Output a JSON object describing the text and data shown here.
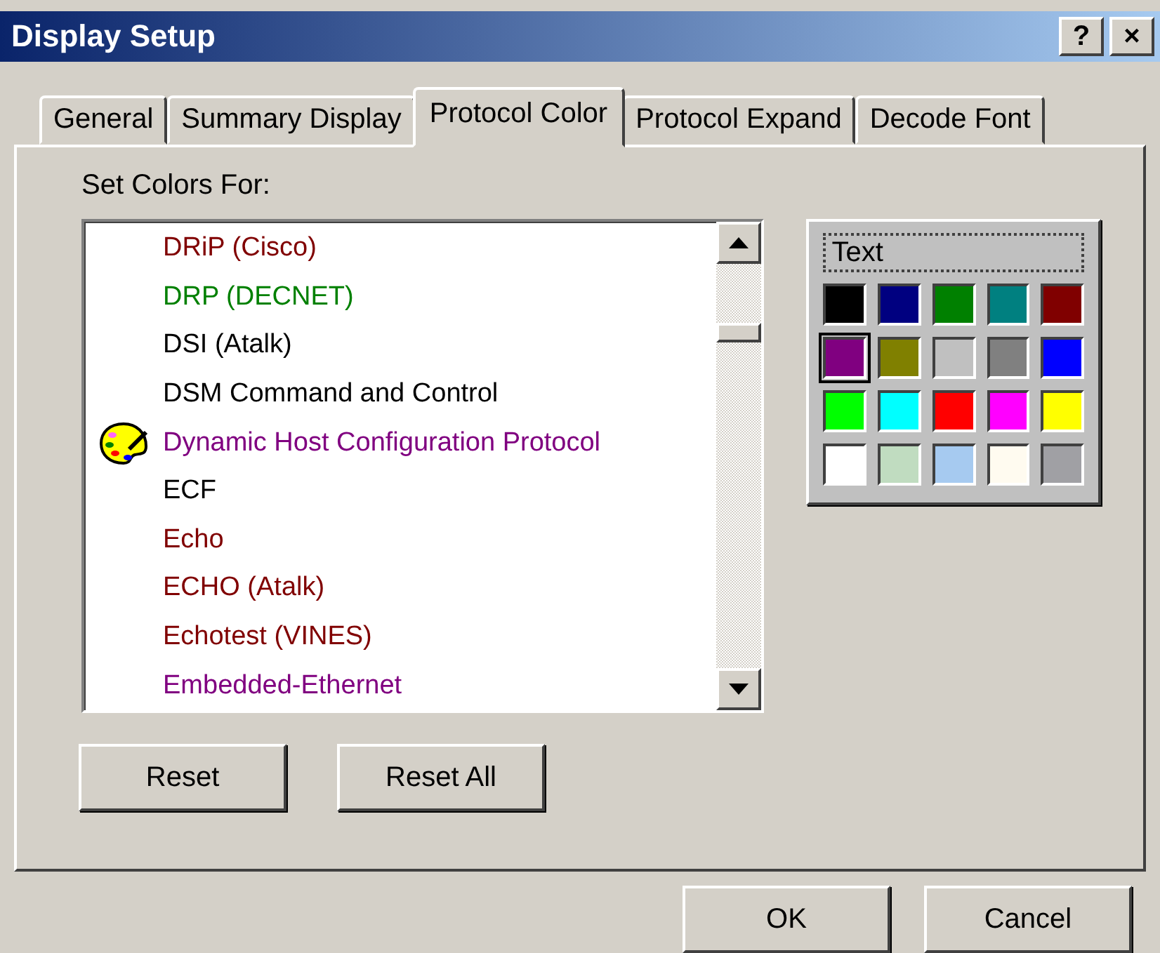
{
  "window": {
    "title": "Display Setup",
    "title_buttons": [
      "?",
      "×"
    ]
  },
  "tabs": [
    {
      "label": "General",
      "selected": false
    },
    {
      "label": "Summary Display",
      "selected": false
    },
    {
      "label": "Protocol Color",
      "selected": true
    },
    {
      "label": "Protocol Expand",
      "selected": false
    },
    {
      "label": "Decode Font",
      "selected": false
    }
  ],
  "list_label": {
    "text": "Set Colors For:"
  },
  "protocols": [
    {
      "name": "DRiP (Cisco)",
      "color": "#800000",
      "selected": false
    },
    {
      "name": "DRP (DECNET)",
      "color": "#008000",
      "selected": false
    },
    {
      "name": "DSI (Atalk)",
      "color": "#000000",
      "selected": false
    },
    {
      "name": "DSM Command and Control",
      "color": "#000000",
      "selected": false
    },
    {
      "name": "Dynamic Host Configuration Protocol",
      "color": "#800080",
      "selected": true
    },
    {
      "name": "ECF",
      "color": "#000000",
      "selected": false
    },
    {
      "name": "Echo",
      "color": "#800000",
      "selected": false
    },
    {
      "name": "ECHO (Atalk)",
      "color": "#800000",
      "selected": false
    },
    {
      "name": "Echotest (VINES)",
      "color": "#800000",
      "selected": false
    },
    {
      "name": "Embedded-Ethernet",
      "color": "#800080",
      "selected": false
    }
  ],
  "palette": {
    "label": "Text",
    "swatches": [
      {
        "color": "#000000",
        "selected": false
      },
      {
        "color": "#000080",
        "selected": false
      },
      {
        "color": "#008000",
        "selected": false
      },
      {
        "color": "#008080",
        "selected": false
      },
      {
        "color": "#800000",
        "selected": false
      },
      {
        "color": "#800080",
        "selected": true
      },
      {
        "color": "#808000",
        "selected": false
      },
      {
        "color": "#c0c0c0",
        "selected": false
      },
      {
        "color": "#808080",
        "selected": false
      },
      {
        "color": "#0000ff",
        "selected": false
      },
      {
        "color": "#00ff00",
        "selected": false
      },
      {
        "color": "#00ffff",
        "selected": false
      },
      {
        "color": "#ff0000",
        "selected": false
      },
      {
        "color": "#ff00ff",
        "selected": false
      },
      {
        "color": "#ffff00",
        "selected": false
      },
      {
        "color": "#ffffff",
        "selected": false
      },
      {
        "color": "#c0dcc0",
        "selected": false
      },
      {
        "color": "#a6caf0",
        "selected": false
      },
      {
        "color": "#fffbf0",
        "selected": false
      },
      {
        "color": "#a0a0a4",
        "selected": false
      }
    ]
  },
  "panel_buttons": [
    {
      "label": "Reset"
    },
    {
      "label": "Reset All"
    }
  ],
  "dialog_buttons": [
    "OK",
    "Cancel"
  ]
}
